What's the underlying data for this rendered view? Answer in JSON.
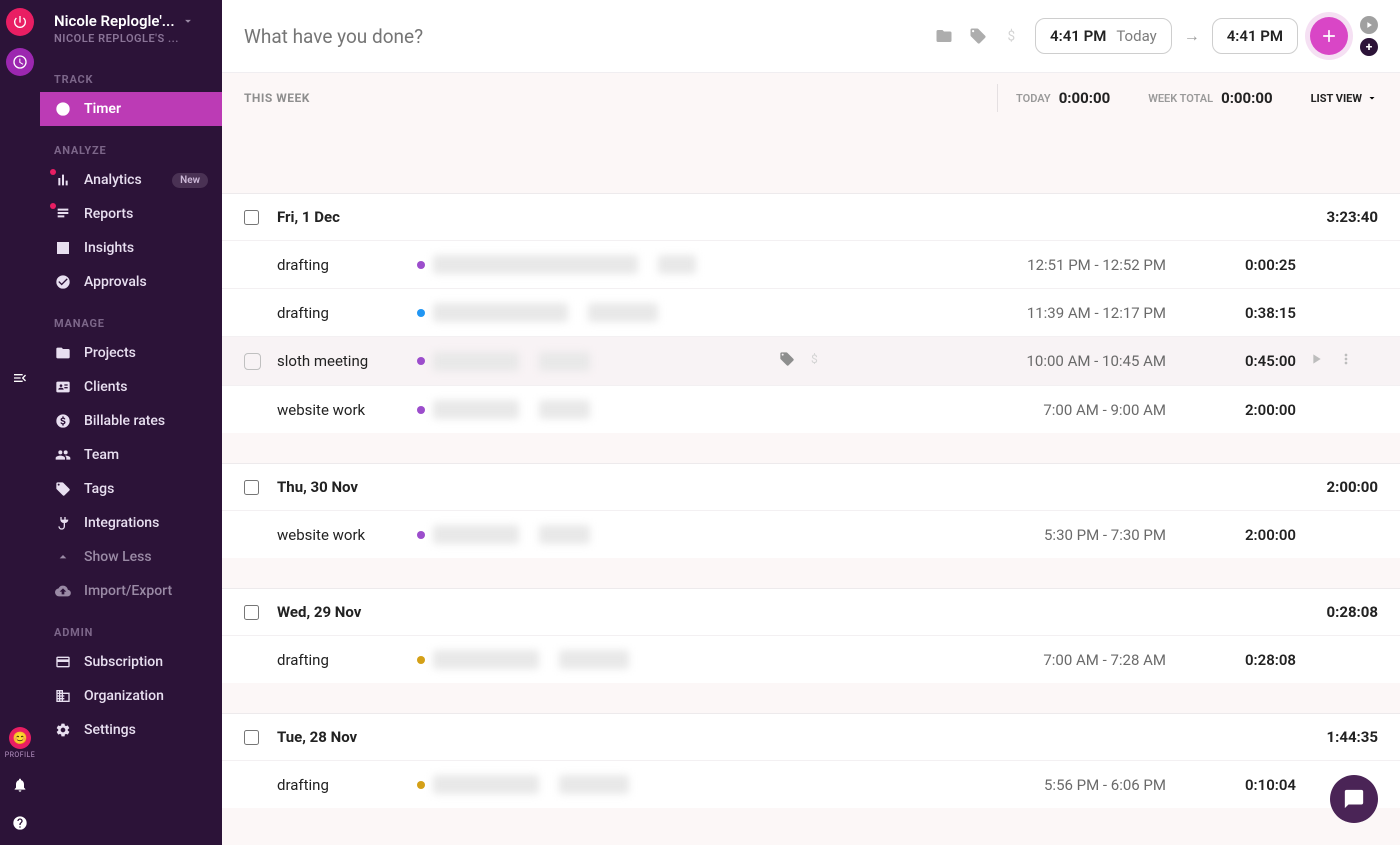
{
  "rail": {
    "profile_label": "PROFILE"
  },
  "sidebar": {
    "workspace": "Nicole Replogle'...",
    "sub": "NICOLE REPLOGLE'S ...",
    "sections": {
      "track": "TRACK",
      "analyze": "ANALYZE",
      "manage": "MANAGE",
      "admin": "ADMIN"
    },
    "items": {
      "timer": "Timer",
      "analytics": "Analytics",
      "analytics_badge": "New",
      "reports": "Reports",
      "insights": "Insights",
      "approvals": "Approvals",
      "projects": "Projects",
      "clients": "Clients",
      "billable": "Billable rates",
      "team": "Team",
      "tags": "Tags",
      "integrations": "Integrations",
      "showless": "Show Less",
      "importexport": "Import/Export",
      "subscription": "Subscription",
      "organization": "Organization",
      "settings": "Settings"
    }
  },
  "topbar": {
    "placeholder": "What have you done?",
    "start_time": "4:41 PM",
    "start_day": "Today",
    "end_time": "4:41 PM"
  },
  "summary": {
    "this_week": "THIS WEEK",
    "today_label": "TODAY",
    "today_val": "0:00:00",
    "week_label": "WEEK TOTAL",
    "week_val": "0:00:00",
    "view": "LIST VIEW"
  },
  "colors": {
    "purple": "#9c4dcc",
    "blue": "#2196f3",
    "yellow": "#d4a017"
  },
  "days": [
    {
      "date": "Fri, 1 Dec",
      "total": "3:23:40",
      "entries": [
        {
          "desc": "drafting",
          "dot": "purple",
          "proj": "xxxxxxx xxxx xxxx xxxxxxx xxxxxx",
          "task": "xxxx",
          "range": "12:51 PM - 12:52 PM",
          "dur": "0:00:25"
        },
        {
          "desc": "drafting",
          "dot": "blue",
          "proj": "xxxxxxx xxxxx xxxxxx",
          "task": "xxxxxxxxx",
          "range": "11:39 AM - 12:17 PM",
          "dur": "0:38:15"
        },
        {
          "desc": "sloth meeting",
          "dot": "purple",
          "proj": "xxxxxxx xxxx",
          "task": "xxxxxx",
          "range": "10:00 AM - 10:45 AM",
          "dur": "0:45:00",
          "hovered": true
        },
        {
          "desc": "website work",
          "dot": "purple",
          "proj": "xxxxxxx xxxx",
          "task": "xxxxxx",
          "range": "7:00 AM - 9:00 AM",
          "dur": "2:00:00"
        }
      ]
    },
    {
      "date": "Thu, 30 Nov",
      "total": "2:00:00",
      "entries": [
        {
          "desc": "website work",
          "dot": "purple",
          "proj": "xxxxxxx xxxx",
          "task": "xxxxxx",
          "range": "5:30 PM - 7:30 PM",
          "dur": "2:00:00"
        }
      ]
    },
    {
      "date": "Wed, 29 Nov",
      "total": "0:28:08",
      "entries": [
        {
          "desc": "drafting",
          "dot": "yellow",
          "proj": "xxxxxxxx xxxxxx",
          "task": "xxxxxxxxx",
          "range": "7:00 AM - 7:28 AM",
          "dur": "0:28:08"
        }
      ]
    },
    {
      "date": "Tue, 28 Nov",
      "total": "1:44:35",
      "entries": [
        {
          "desc": "drafting",
          "dot": "yellow",
          "proj": "xxxxxxxx xxxxxx",
          "task": "xxxxxxxxx",
          "range": "5:56 PM - 6:06 PM",
          "dur": "0:10:04"
        }
      ]
    }
  ]
}
